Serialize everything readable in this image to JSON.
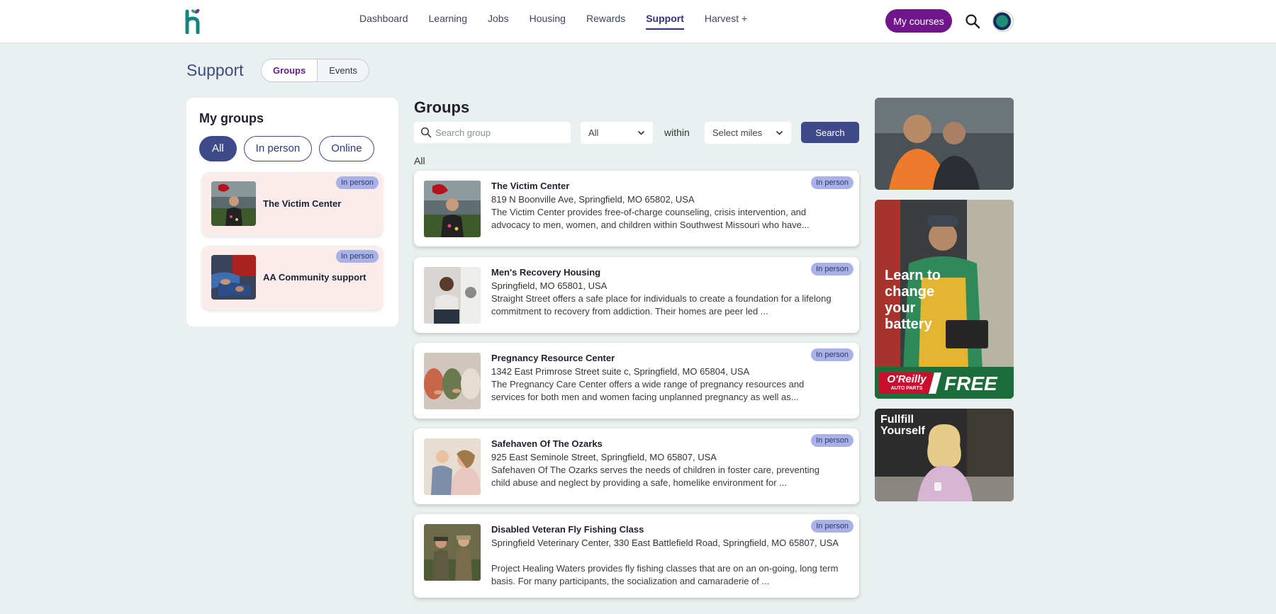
{
  "nav": {
    "items": [
      "Dashboard",
      "Learning",
      "Jobs",
      "Housing",
      "Rewards",
      "Support",
      "Harvest +"
    ],
    "active": "Support",
    "my_courses": "My courses"
  },
  "page": {
    "title": "Support",
    "segments": [
      "Groups",
      "Events"
    ],
    "active_segment": "Groups"
  },
  "my_groups": {
    "title": "My groups",
    "filters": [
      "All",
      "In person",
      "Online"
    ],
    "active_filter": "All",
    "items": [
      {
        "name": "The Victim Center",
        "badge": "In person"
      },
      {
        "name": "AA Community support",
        "badge": "In person"
      }
    ]
  },
  "groups": {
    "title": "Groups",
    "search_placeholder": "Search group",
    "type_select": "All",
    "within": "within",
    "miles_select": "Select miles",
    "search_button": "Search",
    "list_label": "All",
    "items": [
      {
        "name": "The Victim Center",
        "address": "819 N Boonville Ave, Springfield, MO 65802, USA",
        "description": "The Victim Center provides free-of-charge counseling, crisis intervention, and advocacy to men, women, and children within Southwest Missouri who have...",
        "badge": "In person"
      },
      {
        "name": "Men's Recovery Housing",
        "address": "Springfield, MO 65801, USA",
        "description": "Straight Street offers a safe place for individuals to create a foundation for a lifelong commitment to recovery from addiction. Their homes are peer led ...",
        "badge": "In person"
      },
      {
        "name": "Pregnancy Resource Center",
        "address": "1342 East Primrose Street suite c, Springfield, MO 65804, USA",
        "description": "The Pregnancy Care Center offers a wide range of pregnancy resources and services for both men and women facing unplanned pregnancy as well as...",
        "badge": "In person"
      },
      {
        "name": "Safehaven Of The Ozarks",
        "address": "925 East Seminole Street, Springfield, MO 65807, USA",
        "description": "Safehaven Of The Ozarks serves the needs of children in foster care, preventing child abuse and neglect by providing a safe, homelike environment for ...",
        "badge": "In person"
      },
      {
        "name": "Disabled Veteran Fly Fishing Class",
        "address": "Springfield Veterinary Center, 330 East Battlefield Road, Springfield, MO 65807, USA",
        "description": "Project Healing Waters provides fly fishing classes that are on an on-going, long term basis. For many participants, the socialization and camaraderie of ...",
        "badge": "In person"
      }
    ]
  },
  "ads": {
    "oreilly_text": "Learn to change your battery",
    "oreilly_brand": "O'Reilly",
    "oreilly_brand_sub": "AUTO PARTS",
    "oreilly_free": "FREE",
    "fulfill_text": "Fullfill Yourself"
  },
  "colors": {
    "brand_purple": "#6f168a",
    "accent_navy": "#3e4a8a",
    "badge": "#a9b2e6",
    "page_bg": "#eaf0ef"
  }
}
